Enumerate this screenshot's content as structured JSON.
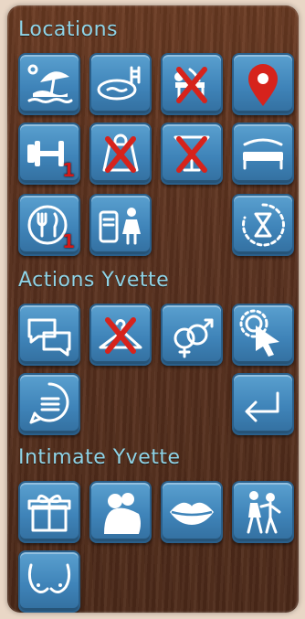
{
  "sections": {
    "locations": {
      "title": "Locations"
    },
    "actions": {
      "title": "Actions Yvette"
    },
    "intimate": {
      "title": "Intimate Yvette"
    }
  },
  "badges": {
    "gym": "1",
    "restaurant": "1"
  },
  "buttons": [
    {
      "id": "beach",
      "icon": "beach-umbrella-icon",
      "disabled": false
    },
    {
      "id": "pool",
      "icon": "swimming-pool-icon",
      "disabled": false
    },
    {
      "id": "massage",
      "icon": "massage-table-icon",
      "disabled": true
    },
    {
      "id": "map",
      "icon": "map-pin-icon",
      "disabled": false
    },
    {
      "id": "gym",
      "icon": "dumbbell-icon",
      "disabled": false
    },
    {
      "id": "shop",
      "icon": "shopping-bag-icon",
      "disabled": true
    },
    {
      "id": "bar",
      "icon": "cocktail-glass-icon",
      "disabled": true
    },
    {
      "id": "bed",
      "icon": "bed-icon",
      "disabled": false
    },
    {
      "id": "restaurant",
      "icon": "fork-knife-icon",
      "disabled": false
    },
    {
      "id": "chat-scene",
      "icon": "phone-chat-girl-icon",
      "disabled": false
    },
    {
      "id": "wait",
      "icon": "hourglass-cycle-icon",
      "disabled": false
    },
    {
      "id": "talk",
      "icon": "speech-bubbles-icon",
      "disabled": false
    },
    {
      "id": "clothes",
      "icon": "clothes-hanger-icon",
      "disabled": true
    },
    {
      "id": "sex",
      "icon": "gender-symbols-icon",
      "disabled": false
    },
    {
      "id": "touch",
      "icon": "pointer-hand-icon",
      "disabled": false
    },
    {
      "id": "menu",
      "icon": "message-menu-icon",
      "disabled": false
    },
    {
      "id": "back",
      "icon": "return-arrow-icon",
      "disabled": false
    },
    {
      "id": "gift",
      "icon": "gift-box-icon",
      "disabled": false
    },
    {
      "id": "hug",
      "icon": "couple-hug-icon",
      "disabled": false
    },
    {
      "id": "kiss",
      "icon": "lips-icon",
      "disabled": false
    },
    {
      "id": "dance",
      "icon": "dancing-couple-icon",
      "disabled": false
    },
    {
      "id": "breasts",
      "icon": "breasts-icon",
      "disabled": false
    }
  ]
}
